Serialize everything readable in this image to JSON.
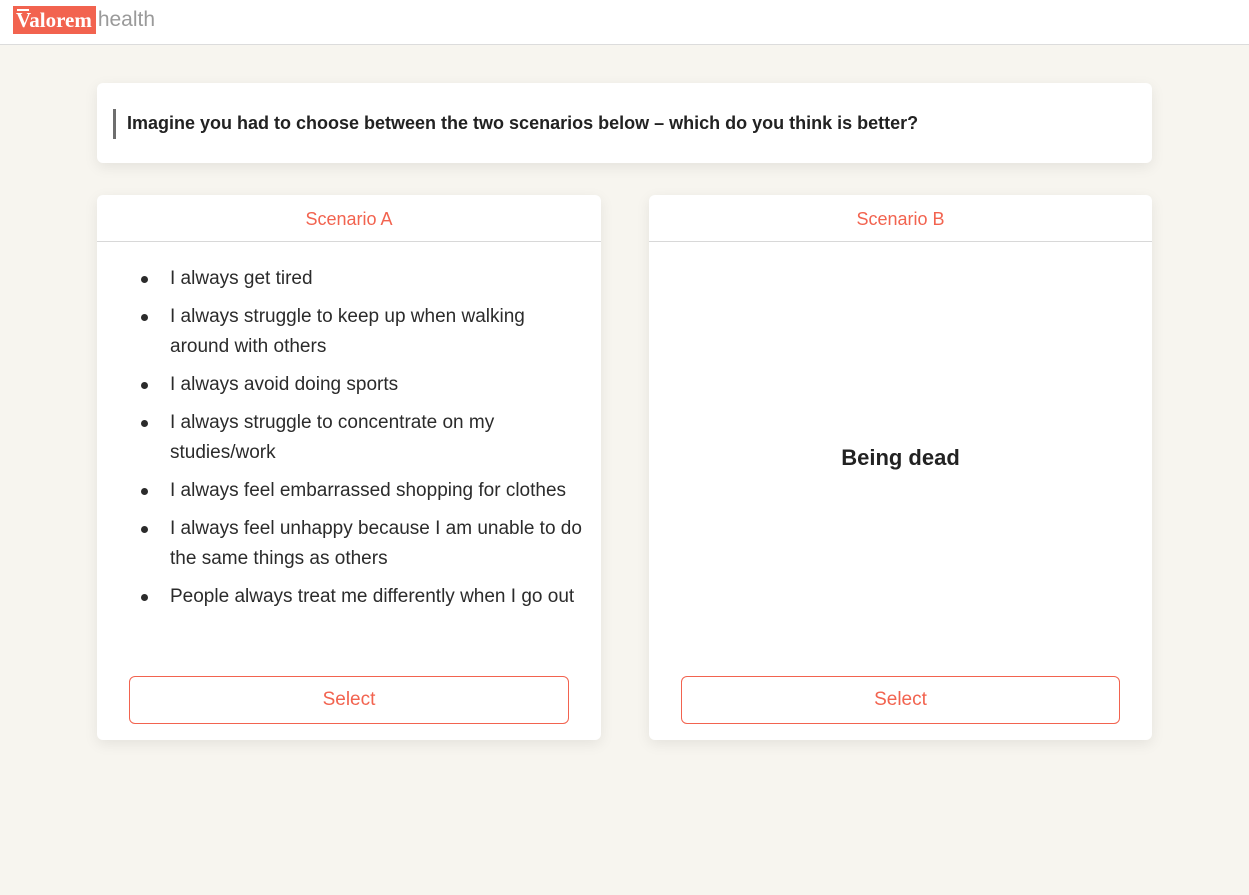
{
  "header": {
    "logo_brand": "Valorem",
    "logo_suffix": "health"
  },
  "question": {
    "text": "Imagine you had to choose between the two scenarios below – which do you think is better?"
  },
  "scenario_a": {
    "title": "Scenario A",
    "items": [
      "I always get tired",
      "I always struggle to keep up when walking around with others",
      "I always avoid doing sports",
      "I always struggle to concentrate on my studies/work",
      "I always feel embarrassed shopping for clothes",
      "I always feel unhappy because I am unable to do the same things as others",
      "People always treat me differently when I go out"
    ],
    "button_label": "Select"
  },
  "scenario_b": {
    "title": "Scenario B",
    "text": "Being dead",
    "button_label": "Select"
  },
  "colors": {
    "accent": "#f2634f",
    "background": "#f7f5ef",
    "card": "#ffffff"
  }
}
